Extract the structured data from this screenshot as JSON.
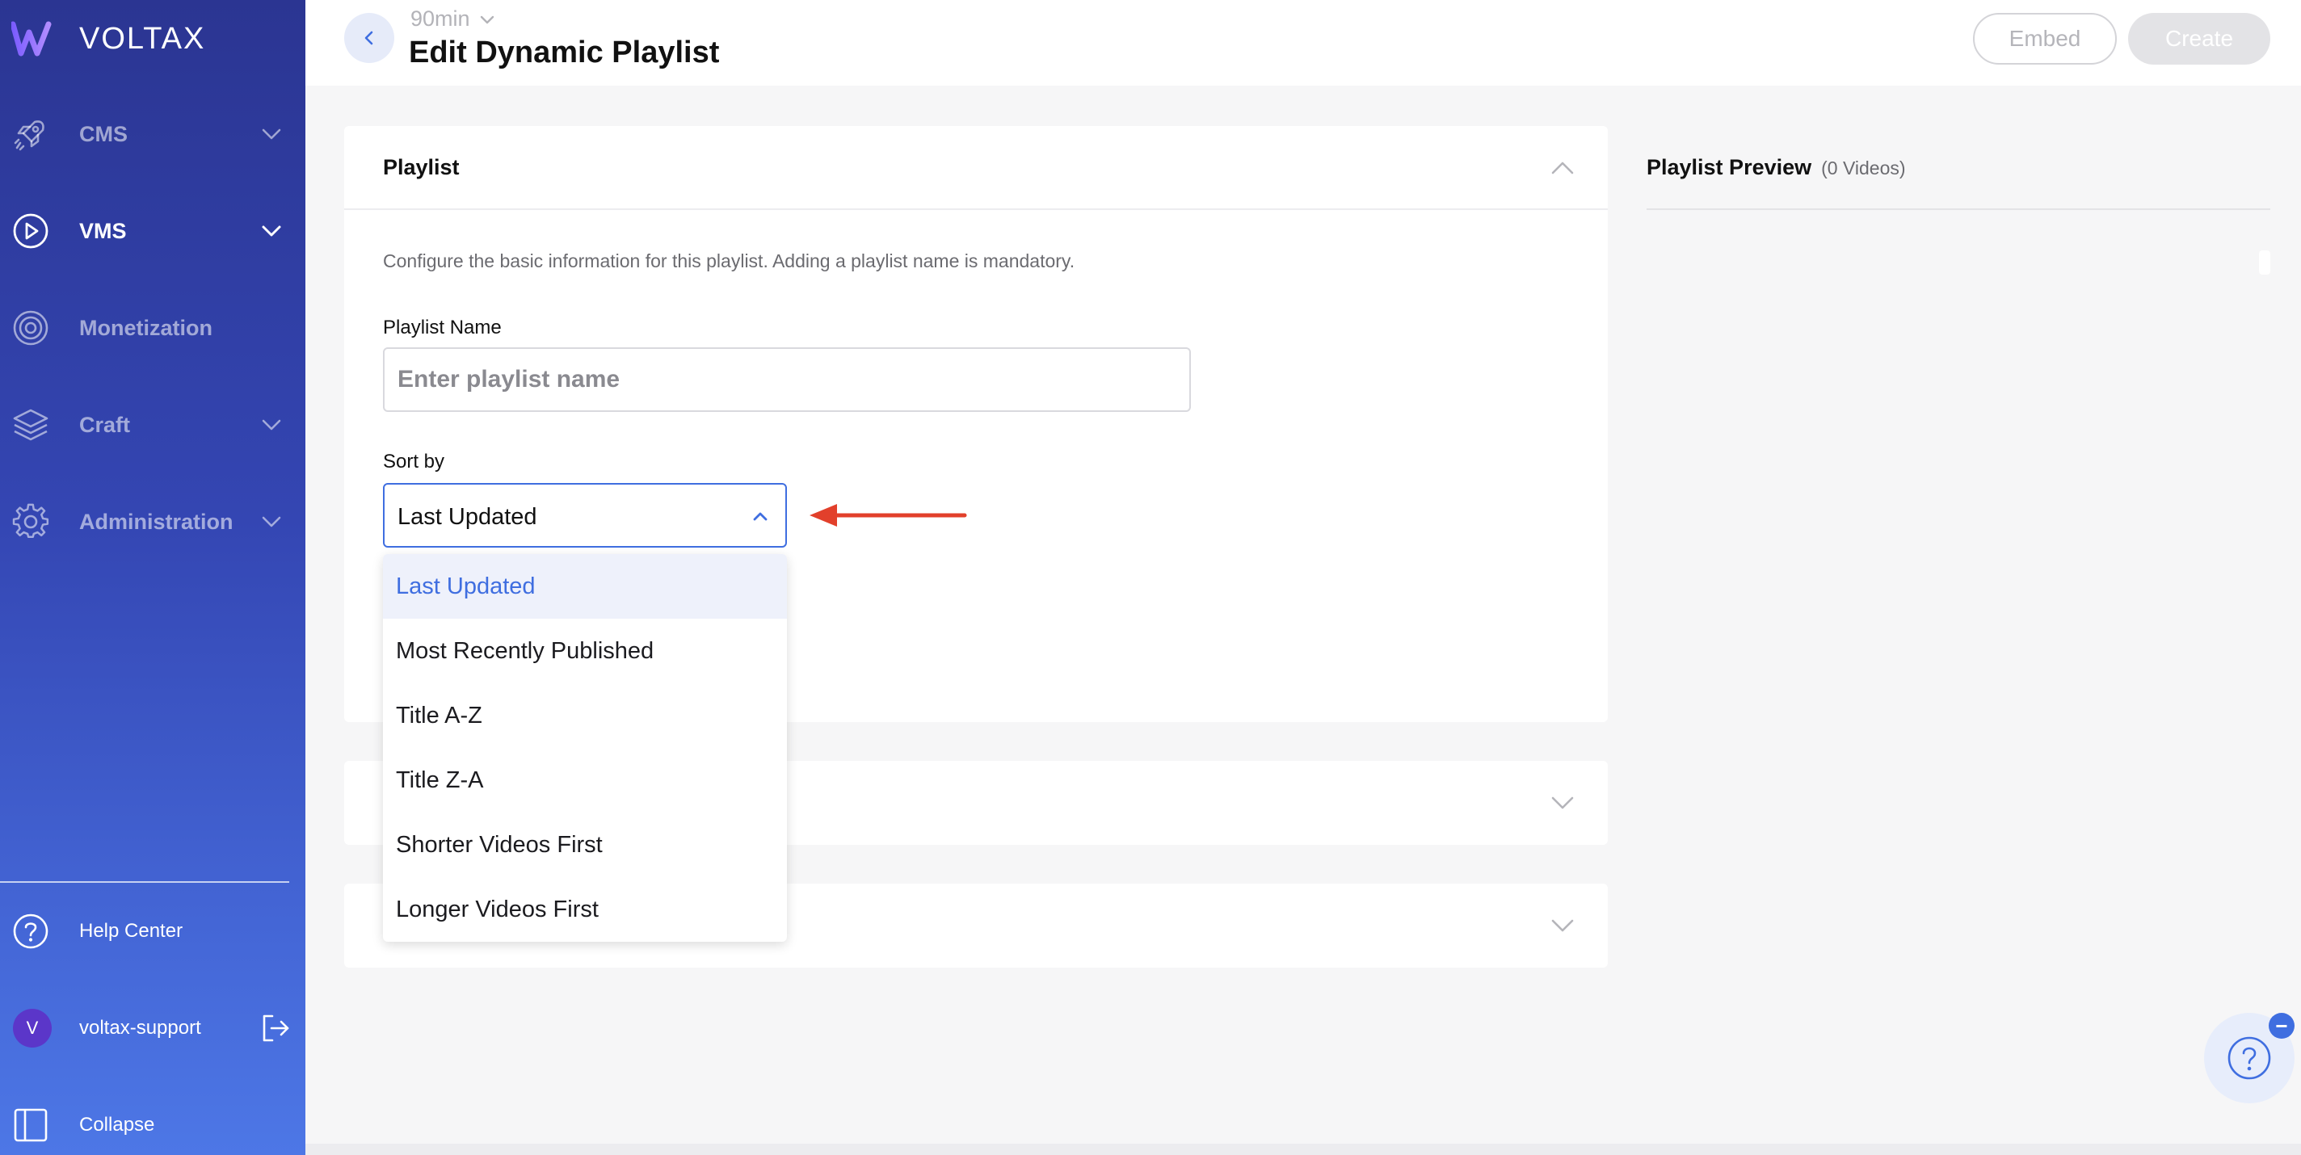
{
  "brand": {
    "name": "VOLTAX"
  },
  "sidebar": {
    "items": [
      {
        "label": "CMS",
        "icon": "rocket-icon",
        "has_chevron": true
      },
      {
        "label": "VMS",
        "icon": "play-circle-icon",
        "has_chevron": true,
        "active": true
      },
      {
        "label": "Monetization",
        "icon": "target-icon",
        "has_chevron": false
      },
      {
        "label": "Craft",
        "icon": "layers-icon",
        "has_chevron": true
      },
      {
        "label": "Administration",
        "icon": "gear-icon",
        "has_chevron": true
      }
    ],
    "help_label": "Help Center",
    "user": {
      "initial": "V",
      "name": "voltax-support"
    },
    "collapse_label": "Collapse"
  },
  "header": {
    "org": "90min",
    "title": "Edit Dynamic Playlist",
    "embed_label": "Embed",
    "create_label": "Create"
  },
  "playlist_card": {
    "title": "Playlist",
    "description": "Configure the basic information for this playlist. Adding a playlist name is mandatory.",
    "name_label": "Playlist Name",
    "name_placeholder": "Enter playlist name",
    "name_value": "",
    "sort_label": "Sort by",
    "sort_value": "Last Updated",
    "sort_options": [
      "Last Updated",
      "Most Recently Published",
      "Title A-Z",
      "Title Z-A",
      "Shorter Videos First",
      "Longer Videos First"
    ]
  },
  "preview": {
    "title": "Playlist Preview",
    "count": "(0 Videos)"
  },
  "colors": {
    "accent": "#3f6ee0",
    "annotation_arrow": "#e2402b",
    "sidebar_top": "#2b3592",
    "sidebar_bottom": "#4d77e6"
  }
}
